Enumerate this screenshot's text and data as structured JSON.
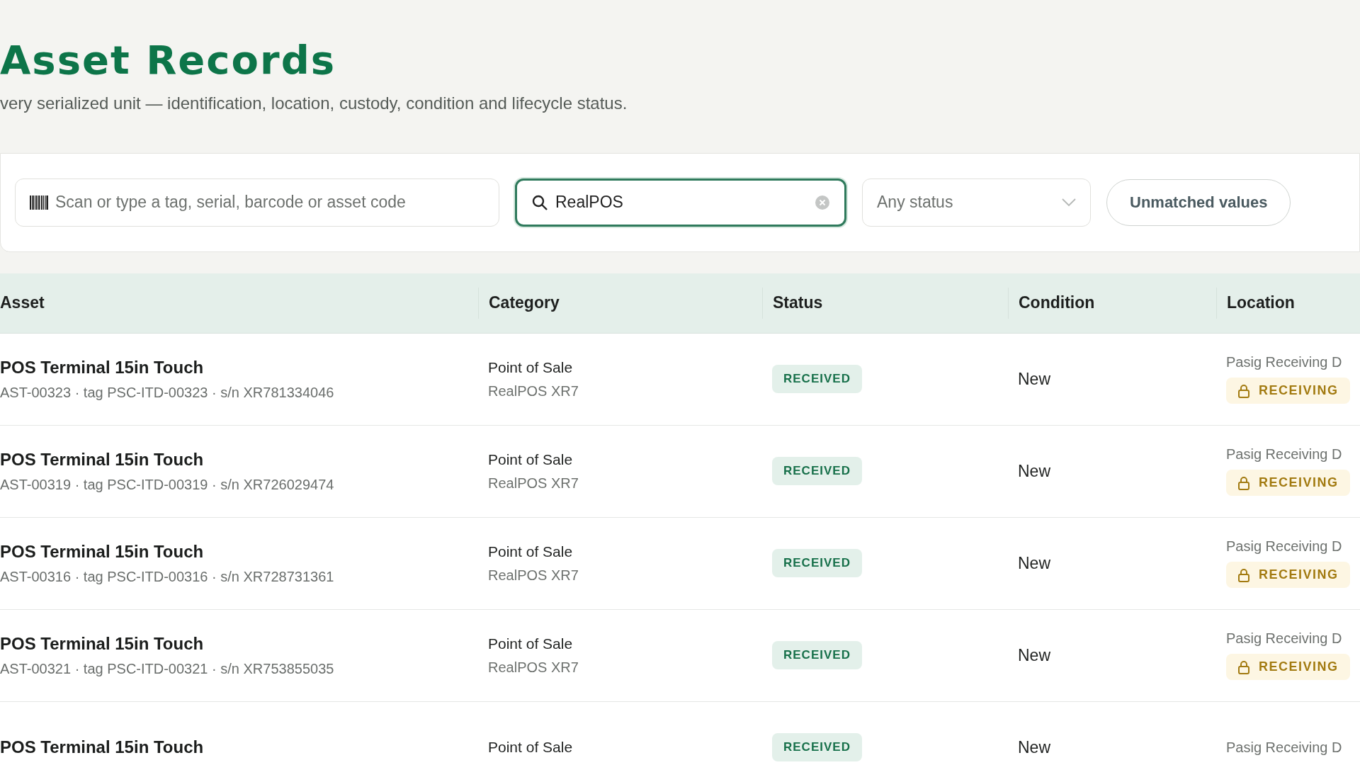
{
  "header": {
    "title": "Asset Records",
    "subtitle": "very serialized unit — identification, location, custody, condition and lifecycle status."
  },
  "filters": {
    "scan": {
      "placeholder": "Scan or type a tag, serial, barcode or asset code"
    },
    "search": {
      "value": "RealPOS",
      "focused": true
    },
    "status_select": {
      "placeholder": "Any status"
    },
    "button": "Unmatched values"
  },
  "table": {
    "columns": [
      "Asset",
      "Category",
      "Status",
      "Condition",
      "Location"
    ],
    "rows": [
      {
        "name": "POS Terminal 15in Touch",
        "ids": "AST-00323 · tag PSC-ITD-00323 · s/n XR781334046",
        "category": "Point of Sale",
        "model": "RealPOS XR7",
        "status": "RECEIVED",
        "condition": "New",
        "location": "Pasig Receiving D",
        "location_badge": "RECEIVING"
      },
      {
        "name": "POS Terminal 15in Touch",
        "ids": "AST-00319 · tag PSC-ITD-00319 · s/n XR726029474",
        "category": "Point of Sale",
        "model": "RealPOS XR7",
        "status": "RECEIVED",
        "condition": "New",
        "location": "Pasig Receiving D",
        "location_badge": "RECEIVING"
      },
      {
        "name": "POS Terminal 15in Touch",
        "ids": "AST-00316 · tag PSC-ITD-00316 · s/n XR728731361",
        "category": "Point of Sale",
        "model": "RealPOS XR7",
        "status": "RECEIVED",
        "condition": "New",
        "location": "Pasig Receiving D",
        "location_badge": "RECEIVING"
      },
      {
        "name": "POS Terminal 15in Touch",
        "ids": "AST-00321 · tag PSC-ITD-00321 · s/n XR753855035",
        "category": "Point of Sale",
        "model": "RealPOS XR7",
        "status": "RECEIVED",
        "condition": "New",
        "location": "Pasig Receiving D",
        "location_badge": "RECEIVING"
      },
      {
        "name": "POS Terminal 15in Touch",
        "category": "Point of Sale",
        "status": "RECEIVED",
        "condition": "New",
        "location": "Pasig Receiving D"
      }
    ]
  }
}
